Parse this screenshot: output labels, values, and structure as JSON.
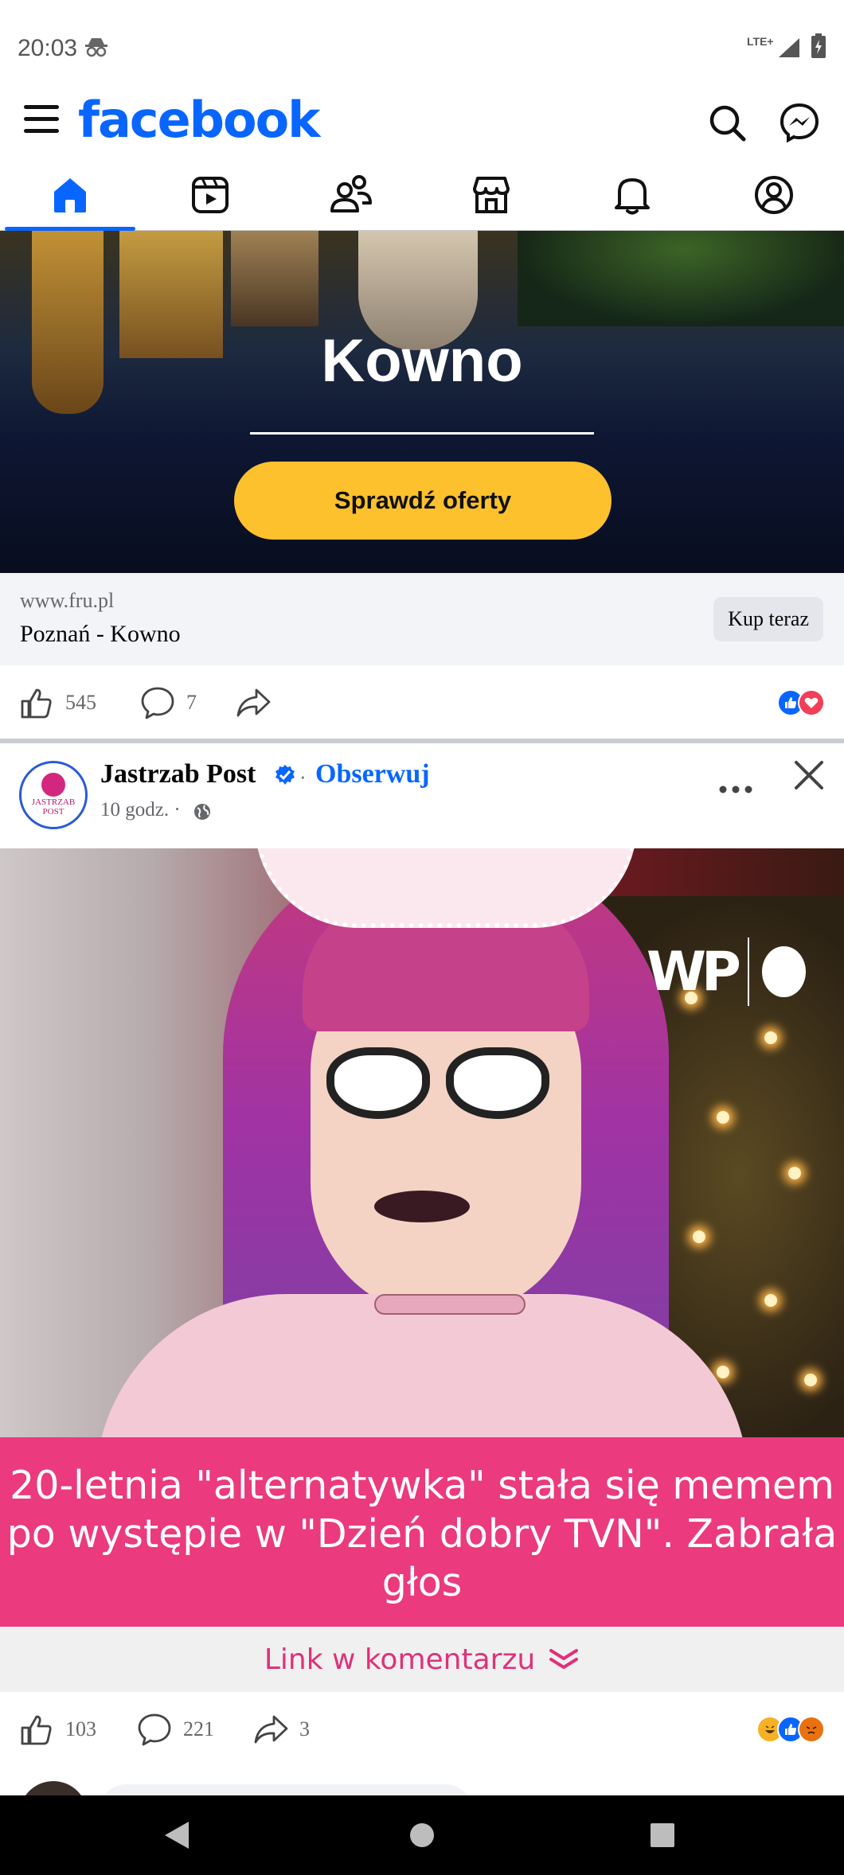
{
  "status_bar": {
    "time": "20:03",
    "network": "LTE+"
  },
  "header": {
    "logo": "facebook",
    "icons": [
      "menu-icon",
      "search-icon",
      "messenger-icon"
    ]
  },
  "tabs": [
    "home-icon",
    "video-icon",
    "friends-icon",
    "marketplace-icon",
    "notifications-icon",
    "profile-icon"
  ],
  "ad": {
    "headline": "Kowno",
    "cta": "Sprawdź oferty",
    "domain": "www.fru.pl",
    "link_title": "Poznań - Kowno",
    "button": "Kup teraz",
    "likes": "545",
    "comments": "7"
  },
  "post": {
    "author": "Jastrzab Post",
    "avatar_text": "JASTRZAB POST",
    "follow": "Obserwuj",
    "separator": "·",
    "time": "10 godz. ·",
    "headline": "20-letnia \"alternatywka\" stała się memem po występie w \"Dzień dobry TVN\". Zabrała głos",
    "link_hint": "Link w komentarzu",
    "likes": "103",
    "comments": "221",
    "shares": "3",
    "watermark": "WP"
  },
  "colors": {
    "brand": "#0866ff",
    "cta": "#fcc12d",
    "banner": "#eb3a7d",
    "link_hint": "#e0317a"
  }
}
